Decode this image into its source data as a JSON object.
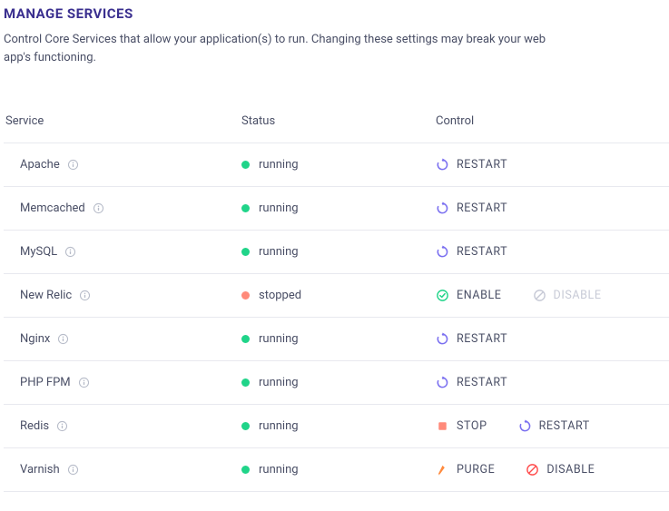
{
  "header": {
    "title": "MANAGE SERVICES",
    "description": "Control Core Services that allow your application(s) to run. Changing these settings may break your web app's functioning."
  },
  "table": {
    "columns": {
      "service": "Service",
      "status": "Status",
      "control": "Control"
    },
    "status_labels": {
      "running": "running",
      "stopped": "stopped"
    },
    "control_labels": {
      "restart": "RESTART",
      "enable": "ENABLE",
      "disable": "DISABLE",
      "stop": "STOP",
      "purge": "PURGE"
    },
    "services": [
      {
        "name": "Apache",
        "status": "running",
        "controls": [
          "restart"
        ]
      },
      {
        "name": "Memcached",
        "status": "running",
        "controls": [
          "restart"
        ]
      },
      {
        "name": "MySQL",
        "status": "running",
        "controls": [
          "restart"
        ]
      },
      {
        "name": "New Relic",
        "status": "stopped",
        "controls": [
          "enable",
          "disable-gray"
        ]
      },
      {
        "name": "Nginx",
        "status": "running",
        "controls": [
          "restart"
        ]
      },
      {
        "name": "PHP FPM",
        "status": "running",
        "controls": [
          "restart"
        ]
      },
      {
        "name": "Redis",
        "status": "running",
        "controls": [
          "stop",
          "restart"
        ]
      },
      {
        "name": "Varnish",
        "status": "running",
        "controls": [
          "purge",
          "disable-red"
        ]
      }
    ]
  },
  "colors": {
    "title": "#3a2f8f",
    "running": "#20d489",
    "stopped": "#ff8a7a",
    "restart_icon": "#7a6ff0",
    "purge_icon": "#ff8a3d",
    "disable_red": "#ff4d4d",
    "disable_gray": "#c7cad6"
  }
}
